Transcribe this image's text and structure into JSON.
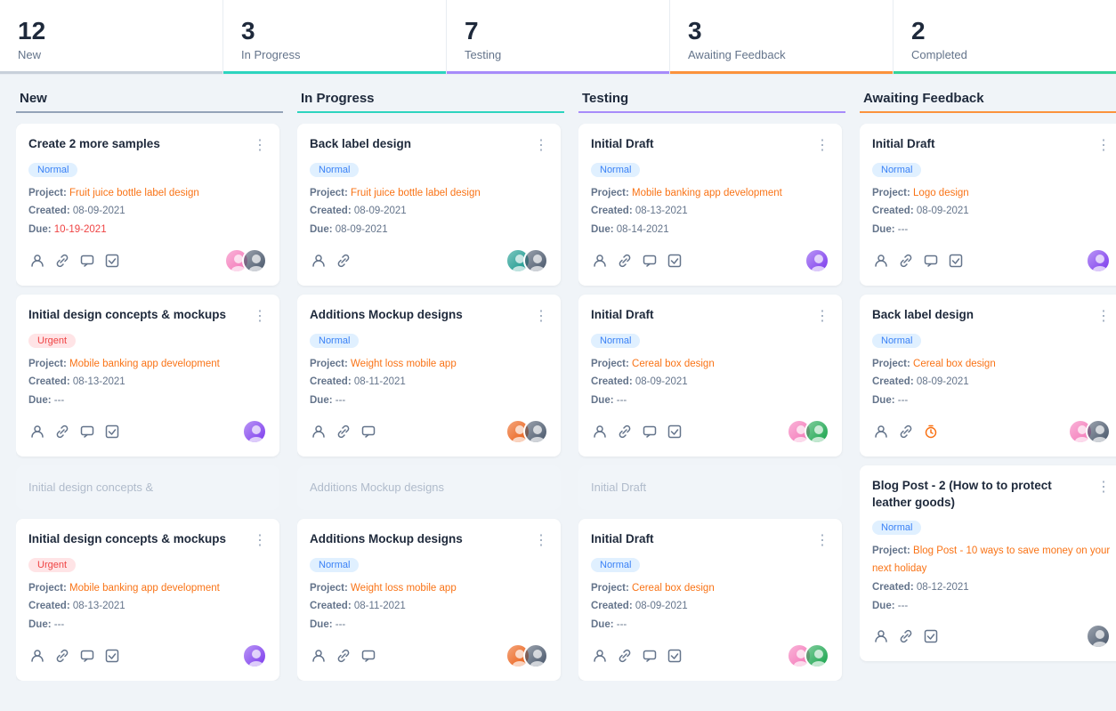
{
  "stats": [
    {
      "id": "new",
      "count": "12",
      "label": "New",
      "colorClass": "new"
    },
    {
      "id": "in-progress",
      "count": "3",
      "label": "In Progress",
      "colorClass": "in-progress"
    },
    {
      "id": "testing",
      "count": "7",
      "label": "Testing",
      "colorClass": "testing"
    },
    {
      "id": "awaiting",
      "count": "3",
      "label": "Awaiting Feedback",
      "colorClass": "awaiting"
    },
    {
      "id": "completed",
      "count": "2",
      "label": "Completed",
      "colorClass": "completed"
    }
  ],
  "columns": [
    {
      "id": "new",
      "label": "New",
      "colorClass": "col-new",
      "cards": [
        {
          "title": "Create 2 more samples",
          "badge": "Normal",
          "badgeClass": "badge-normal",
          "project": "Fruit juice bottle label design",
          "projectColor": "orange",
          "created": "08-09-2021",
          "due": "10-19-2021",
          "dueOverdue": true,
          "icons": [
            "person",
            "link",
            "chat",
            "check"
          ],
          "avatars": [
            "av-pink",
            "av-dark"
          ]
        },
        {
          "title": "Initial design concepts & mockups",
          "badge": "Urgent",
          "badgeClass": "badge-urgent",
          "project": "Mobile banking app development",
          "projectColor": "orange",
          "created": "08-13-2021",
          "due": "---",
          "dueOverdue": false,
          "icons": [
            "person",
            "link",
            "chat",
            "check"
          ],
          "avatars": [
            "av-brown"
          ]
        },
        {
          "divider": true,
          "title": "Initial design concepts &"
        },
        {
          "title": "Initial design concepts & mockups",
          "badge": "Urgent",
          "badgeClass": "badge-urgent",
          "project": "Mobile banking app development",
          "projectColor": "orange",
          "created": "08-13-2021",
          "due": "---",
          "dueOverdue": false,
          "icons": [
            "person",
            "link",
            "chat",
            "check"
          ],
          "avatars": [
            "av-brown"
          ]
        }
      ]
    },
    {
      "id": "in-progress",
      "label": "In Progress",
      "colorClass": "col-inprogress",
      "cards": [
        {
          "title": "Back label design",
          "badge": "Normal",
          "badgeClass": "badge-normal",
          "project": "Fruit juice bottle label design",
          "projectColor": "orange",
          "created": "08-09-2021",
          "due": "08-09-2021",
          "dueOverdue": false,
          "icons": [
            "person",
            "link"
          ],
          "avatars": [
            "av-teal",
            "av-dark"
          ]
        },
        {
          "title": "Additions Mockup designs",
          "badge": "Normal",
          "badgeClass": "badge-normal",
          "project": "Weight loss mobile app",
          "projectColor": "orange",
          "created": "08-11-2021",
          "due": "---",
          "dueOverdue": false,
          "icons": [
            "person",
            "link",
            "chat"
          ],
          "avatars": [
            "av-orange",
            "av-dark"
          ]
        },
        {
          "divider": true,
          "title": "Additions Mockup designs"
        },
        {
          "title": "Additions Mockup designs",
          "badge": "Normal",
          "badgeClass": "badge-normal",
          "project": "Weight loss mobile app",
          "projectColor": "orange",
          "created": "08-11-2021",
          "due": "---",
          "dueOverdue": false,
          "icons": [
            "person",
            "link",
            "chat"
          ],
          "avatars": [
            "av-orange",
            "av-dark"
          ]
        }
      ]
    },
    {
      "id": "testing",
      "label": "Testing",
      "colorClass": "col-testing",
      "cards": [
        {
          "title": "Initial Draft",
          "badge": "Normal",
          "badgeClass": "badge-normal",
          "project": "Mobile banking app development",
          "projectColor": "orange",
          "created": "08-13-2021",
          "due": "08-14-2021",
          "dueOverdue": false,
          "icons": [
            "person",
            "link",
            "chat",
            "check"
          ],
          "avatars": [
            "av-brown"
          ]
        },
        {
          "title": "Initial Draft",
          "badge": "Normal",
          "badgeClass": "badge-normal",
          "project": "Cereal box design",
          "projectColor": "orange",
          "created": "08-09-2021",
          "due": "---",
          "dueOverdue": false,
          "icons": [
            "person",
            "link",
            "chat",
            "check"
          ],
          "avatars": [
            "av-pink",
            "av-green"
          ]
        },
        {
          "divider": true,
          "title": "Initial Draft"
        },
        {
          "title": "Initial Draft",
          "badge": "Normal",
          "badgeClass": "badge-normal",
          "project": "Cereal box design",
          "projectColor": "orange",
          "created": "08-09-2021",
          "due": "---",
          "dueOverdue": false,
          "icons": [
            "person",
            "link",
            "chat",
            "check"
          ],
          "avatars": [
            "av-pink",
            "av-green"
          ]
        }
      ]
    },
    {
      "id": "awaiting",
      "label": "Awaiting Feedback",
      "colorClass": "col-awaiting",
      "cards": [
        {
          "title": "Initial Draft",
          "badge": "Normal",
          "badgeClass": "badge-normal",
          "project": "Logo design",
          "projectColor": "orange",
          "created": "08-09-2021",
          "due": "---",
          "dueOverdue": false,
          "icons": [
            "person",
            "link",
            "chat",
            "check"
          ],
          "avatars": [
            "av-brown"
          ]
        },
        {
          "title": "Back label design",
          "badge": "Normal",
          "badgeClass": "badge-normal",
          "project": "Cereal box design",
          "projectColor": "orange",
          "created": "08-09-2021",
          "due": "---",
          "dueOverdue": false,
          "icons": [
            "person",
            "link",
            "timer"
          ],
          "avatars": [
            "av-pink",
            "av-dark"
          ]
        },
        {
          "title": "Blog Post - 2 (How to to protect leather goods)",
          "badge": "Normal",
          "badgeClass": "badge-normal",
          "project": "Blog Post - 10 ways to save money on your next holiday",
          "projectColor": "orange",
          "created": "08-12-2021",
          "due": "---",
          "dueOverdue": false,
          "icons": [
            "person",
            "link",
            "check"
          ],
          "avatars": [
            "av-dark"
          ]
        }
      ]
    }
  ],
  "icons": {
    "person": "👤",
    "link": "🔗",
    "chat": "💬",
    "check": "✓",
    "timer": "⏱",
    "menu": "⋮"
  }
}
